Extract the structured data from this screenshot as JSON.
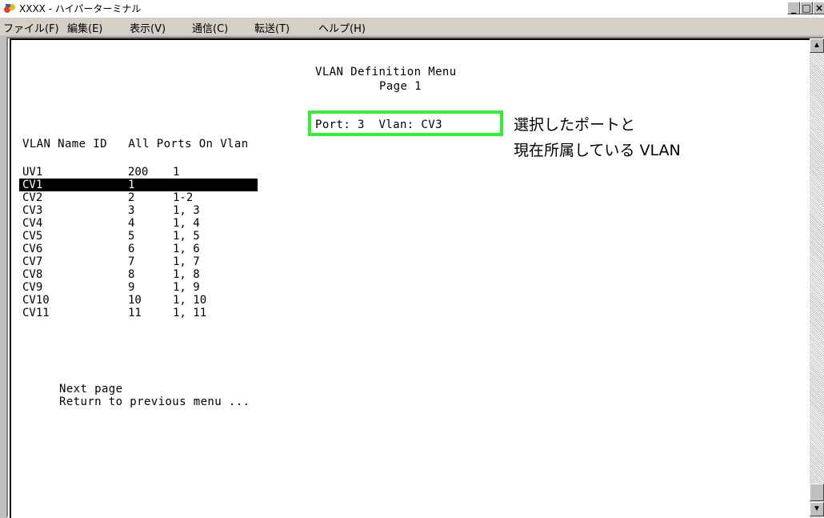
{
  "window": {
    "title": "XXXX - ハイパーターミナル",
    "controls": [
      "_",
      "□",
      "×"
    ]
  },
  "menu": {
    "items": [
      "ファイル(F)",
      "編集(E)",
      "表示(V)",
      "通信(C)",
      "転送(T)",
      "ヘルプ(H)"
    ]
  },
  "terminal": {
    "heading": "VLAN Definition Menu",
    "page": "Page 1",
    "port_line": "Port: 3  Vlan: CV3",
    "col_header": "VLAN Name ID   All Ports On Vlan",
    "rows": [
      {
        "name": "UV1",
        "id": "200",
        "ports": "1"
      },
      {
        "name": "CV1",
        "id": "1",
        "ports": ""
      },
      {
        "name": "CV2",
        "id": "2",
        "ports": "1-2"
      },
      {
        "name": "CV3",
        "id": "3",
        "ports": "1, 3"
      },
      {
        "name": "CV4",
        "id": "4",
        "ports": "1, 4"
      },
      {
        "name": "CV5",
        "id": "5",
        "ports": "1, 5"
      },
      {
        "name": "CV6",
        "id": "6",
        "ports": "1, 6"
      },
      {
        "name": "CV7",
        "id": "7",
        "ports": "1, 7"
      },
      {
        "name": "CV8",
        "id": "8",
        "ports": "1, 8"
      },
      {
        "name": "CV9",
        "id": "9",
        "ports": "1, 9"
      },
      {
        "name": "CV10",
        "id": "10",
        "ports": "1, 10"
      },
      {
        "name": "CV11",
        "id": "11",
        "ports": "1, 11"
      }
    ],
    "selected_row": "CV1",
    "next_page": "Next page",
    "return_menu": "Return to previous menu ..."
  },
  "annotation": {
    "line1": "選択したポートと",
    "line2": "現在所属している VLAN",
    "box_color": "#33ee33"
  },
  "colors": {
    "highlight_bg": "#000000",
    "highlight_fg": "#ffffff"
  }
}
